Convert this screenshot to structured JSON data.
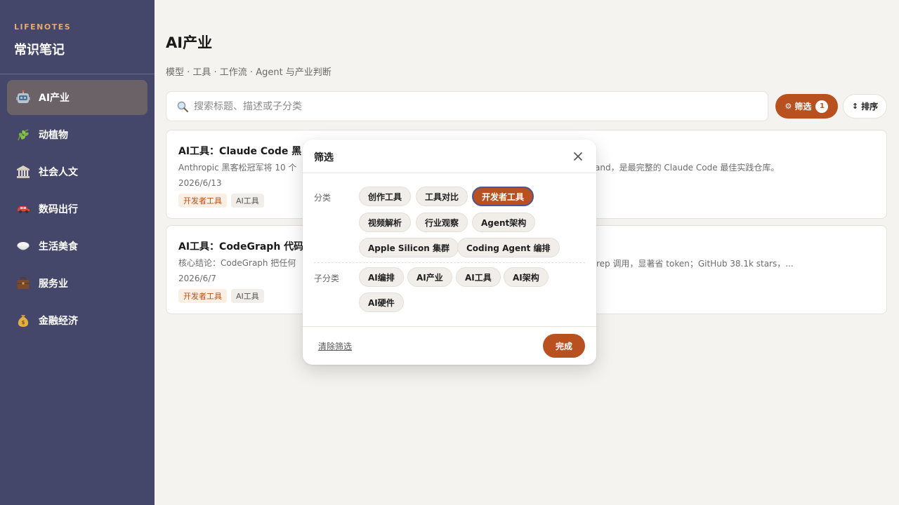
{
  "sidebar": {
    "brand_en": "LIFENOTES",
    "brand_zh": "常识笔记",
    "items": [
      {
        "label": "AI产业",
        "icon": "robot-icon",
        "active": true
      },
      {
        "label": "动植物",
        "icon": "leaf-icon"
      },
      {
        "label": "社会人文",
        "icon": "museum-icon"
      },
      {
        "label": "数码出行",
        "icon": "car-icon"
      },
      {
        "label": "生活美食",
        "icon": "rice-bowl-icon"
      },
      {
        "label": "服务业",
        "icon": "briefcase-icon"
      },
      {
        "label": "金融经济",
        "icon": "money-bag-icon"
      }
    ]
  },
  "header": {
    "title": "AI产业",
    "subtitle": "模型 · 工具 · 工作流 · Agent 与产业判断"
  },
  "search": {
    "placeholder": "搜索标题、描述或子分类",
    "value": ""
  },
  "toolbar": {
    "filter_label": "筛选",
    "filter_count": "1",
    "sort_label": "排序"
  },
  "cards": [
    {
      "title_visible": "AI工具：Claude Code 黑",
      "desc_left": "Anthropic 黑客松冠军将 10 个",
      "desc_right": "and，是最完整的 Claude Code 最佳实践仓库。",
      "date": "2026/6/13",
      "tags": [
        "开发者工具",
        "AI工具"
      ]
    },
    {
      "title_visible": "AI工具：CodeGraph 代码",
      "desc_left": "核心结论：CodeGraph 把任何",
      "desc_right": "rep 调用，显著省 token；GitHub 38.1k stars，...",
      "date": "2026/6/7",
      "tags": [
        "开发者工具",
        "AI工具"
      ]
    }
  ],
  "filter_modal": {
    "title": "筛选",
    "category_label": "分类",
    "categories": [
      "创作工具",
      "工具对比",
      "开发者工具",
      "视频解析",
      "行业观察",
      "Agent架构",
      "Apple Silicon 集群",
      "Coding Agent 编排"
    ],
    "selected_category": "开发者工具",
    "subcategory_label": "子分类",
    "subcategories": [
      "AI编排",
      "AI产业",
      "AI工具",
      "AI架构",
      "AI硬件"
    ],
    "clear_label": "清除筛选",
    "done_label": "完成"
  },
  "colors": {
    "sidebar_bg": "#44476a",
    "accent": "#b9501f",
    "brand_accent": "#e8a86a",
    "page_bg": "#f5f3ef"
  }
}
